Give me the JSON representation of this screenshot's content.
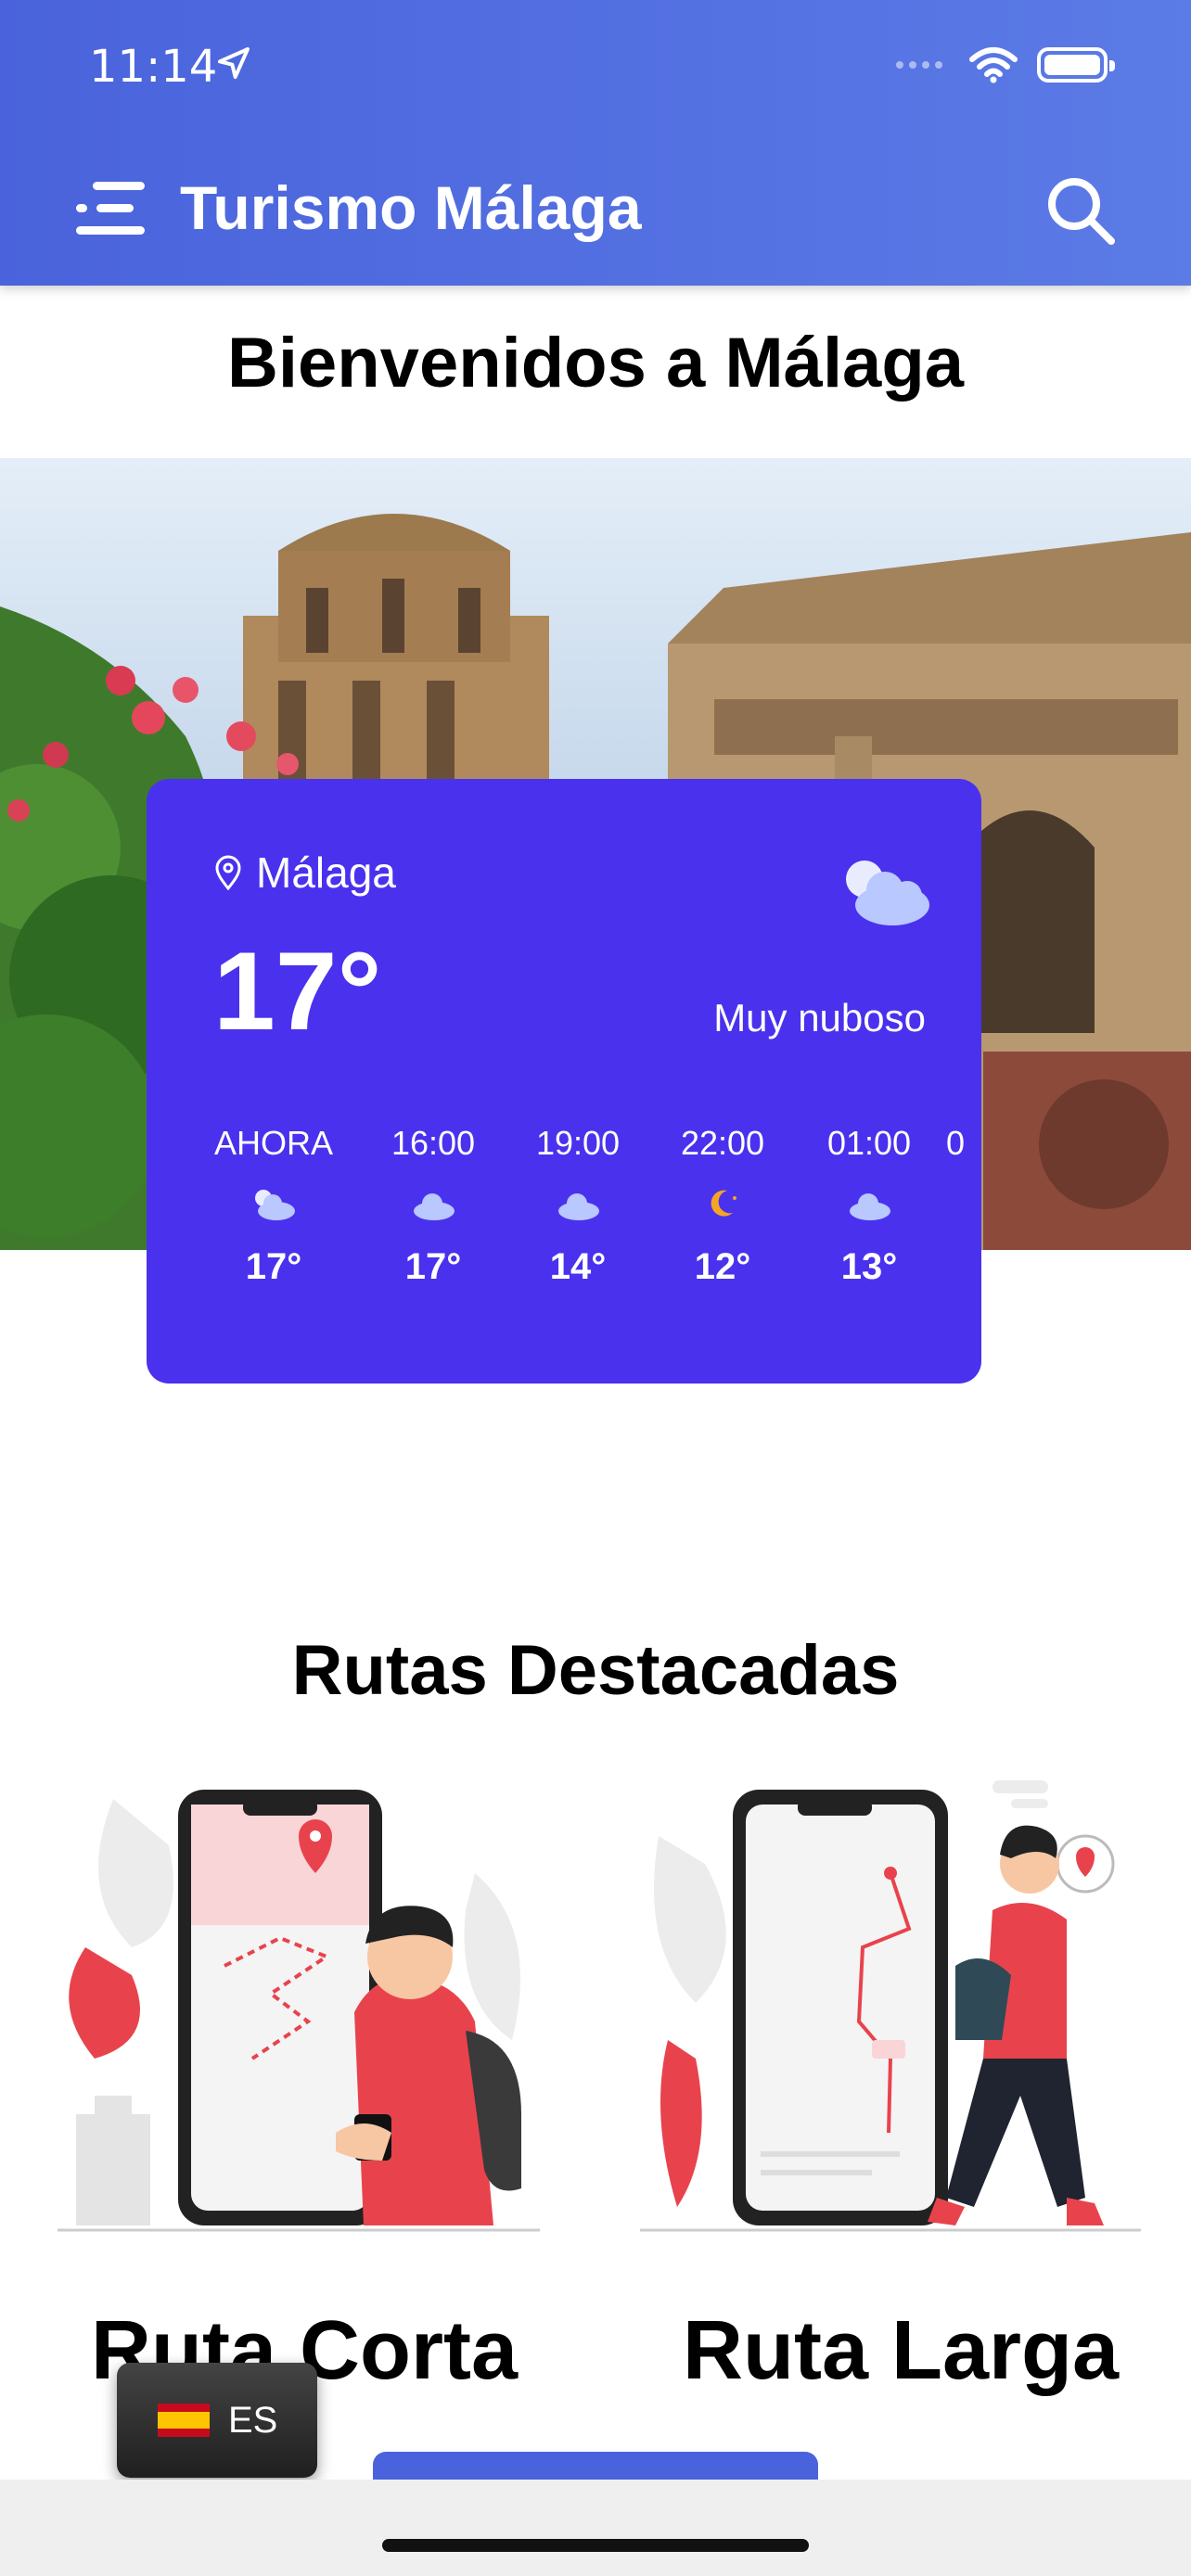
{
  "status_bar": {
    "time": "11:14"
  },
  "header": {
    "title": "Turismo Málaga"
  },
  "welcome": "Bienvenidos a Málaga",
  "weather": {
    "location": "Málaga",
    "temperature": "17°",
    "condition": "Muy nuboso",
    "hourly": [
      {
        "label": "AHORA",
        "icon": "cloud-icon",
        "temp": "17°"
      },
      {
        "label": "16:00",
        "icon": "cloud-icon",
        "temp": "17°"
      },
      {
        "label": "19:00",
        "icon": "cloud-icon",
        "temp": "14°"
      },
      {
        "label": "22:00",
        "icon": "moon-icon",
        "temp": "12°"
      },
      {
        "label": "01:00",
        "icon": "cloud-icon",
        "temp": "13°"
      },
      {
        "label": "0",
        "icon": "cloud-icon",
        "temp": ""
      }
    ]
  },
  "routes": {
    "title": "Rutas Destacadas",
    "items": [
      {
        "label": "Ruta Corta"
      },
      {
        "label": "Ruta Larga"
      }
    ]
  },
  "language": {
    "code": "ES"
  },
  "colors": {
    "header": "#4a63dc",
    "weather_card": "#4a31ee",
    "accent_red": "#e8434c"
  }
}
